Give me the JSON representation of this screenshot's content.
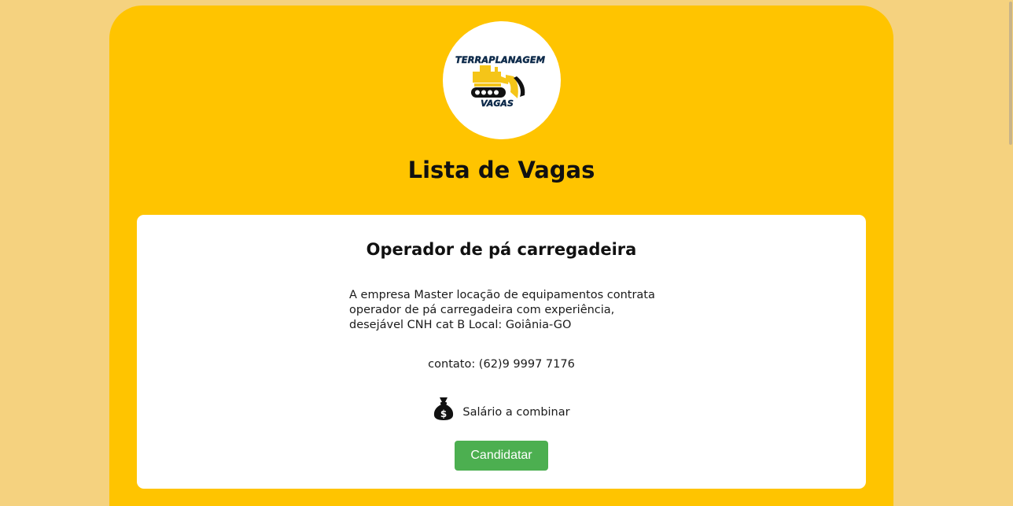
{
  "logo": {
    "line1": "TERRAPLANAGEM",
    "line2": "VAGAS",
    "icon": "bulldozer-icon"
  },
  "page": {
    "title": "Lista de Vagas"
  },
  "jobs": [
    {
      "title": "Operador de pá carregadeira",
      "description": "A empresa Master locação de equipamentos contrata operador de pá carregadeira com experiência, desejável CNH cat B Local: Goiânia-GO",
      "contact": "contato: (62)9 9997 7176",
      "salary_icon": "money-bag-icon",
      "salary": "Salário a combinar",
      "apply_label": "Candidatar"
    }
  ],
  "colors": {
    "background": "#f5d27f",
    "panel": "#ffc400",
    "card": "#ffffff",
    "button": "#4caf50"
  }
}
